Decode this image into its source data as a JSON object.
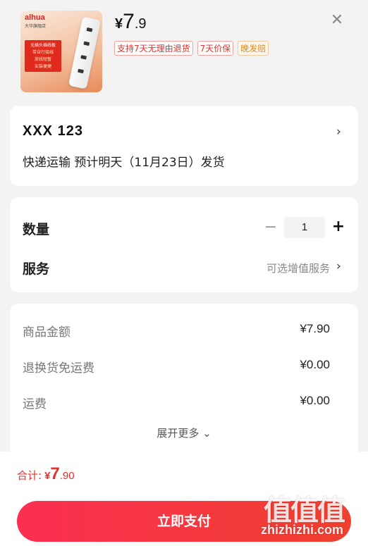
{
  "product": {
    "thumbnail": {
      "brand": "alhua",
      "brand_sub": "大华旗舰店",
      "tag_title": "无插头插线板",
      "tag_lines": [
        "带自行接线",
        "放线短暂",
        "安装便捷"
      ]
    },
    "price": {
      "currency": "¥",
      "integer": "7",
      "decimal": ".9"
    },
    "tags": [
      "支持7天无理由退货",
      "7天价保",
      "晚发赔"
    ],
    "close_icon": "close-icon"
  },
  "address": {
    "name": "XXX  123",
    "shipping": "快递运输 预计明天（11月23日）发货"
  },
  "options": {
    "quantity_label": "数量",
    "quantity_value": "1",
    "minus": "−",
    "plus": "+",
    "service_label": "服务",
    "service_placeholder": "可选增值服务"
  },
  "cost": {
    "rows": [
      {
        "label": "商品金额",
        "value": "¥7.90"
      },
      {
        "label": "退换货免运费",
        "value": "¥0.00"
      },
      {
        "label": "运费",
        "value": "¥0.00"
      }
    ],
    "expand_label": "展开更多"
  },
  "footer": {
    "total_label": "合计:",
    "total_currency": "¥",
    "total_integer": "7",
    "total_decimal": ".90",
    "pay_button": "立即支付"
  },
  "watermark": {
    "logo": "值值值",
    "url": "zhizhizhi.com"
  },
  "colors": {
    "accent": "#e5312b",
    "button_start": "#fb2f52",
    "button_end": "#f0402e",
    "late_tag": "#d98a22"
  }
}
